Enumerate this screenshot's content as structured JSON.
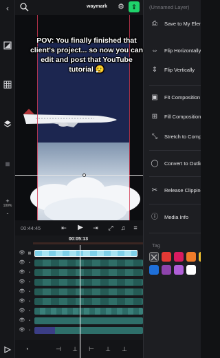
{
  "header": {
    "project_name": "waymark",
    "settings_icon": "gear-icon",
    "export_icon": "export-icon"
  },
  "left_rail": {
    "tools": [
      "magic-wand-icon",
      "aspect-ratio-icon",
      "grid-icon",
      "layers-icon",
      "camera-icon"
    ],
    "zoom_label": "100%",
    "zoom_in": "+",
    "zoom_out": "-"
  },
  "canvas": {
    "caption": "POV: You finally finished that client's project... so now you can edit and post that YouTube tutorial 😮‍💨"
  },
  "panel": {
    "layer_name": "(Unnamed Layer)",
    "menu": [
      {
        "label": "Save to My Elements",
        "icon": "save-icon"
      },
      {
        "label": "Flip Horizontally",
        "icon": "flip-horizontal-icon"
      },
      {
        "label": "Flip Vertically",
        "icon": "flip-vertical-icon"
      },
      {
        "label": "Fit Composition",
        "icon": "fit-icon"
      },
      {
        "label": "Fill Composition",
        "icon": "fill-icon"
      },
      {
        "label": "Stretch to Composition",
        "icon": "stretch-icon"
      },
      {
        "label": "Convert to Outline",
        "icon": "outline-icon"
      },
      {
        "label": "Release Clipping",
        "icon": "clipping-icon"
      },
      {
        "label": "Media Info",
        "icon": "info-icon"
      }
    ],
    "tag_title": "Tag",
    "tag_colors": [
      "#e53935",
      "#d81b60",
      "#ef7c2a",
      "#f2c230",
      "#1e6fd9",
      "#8e44ad",
      "#b05fd8",
      "#ffffff"
    ]
  },
  "playback": {
    "timecode": "00:44:45"
  },
  "timeline": {
    "current_time": "00:05:13",
    "track_count": 10
  }
}
